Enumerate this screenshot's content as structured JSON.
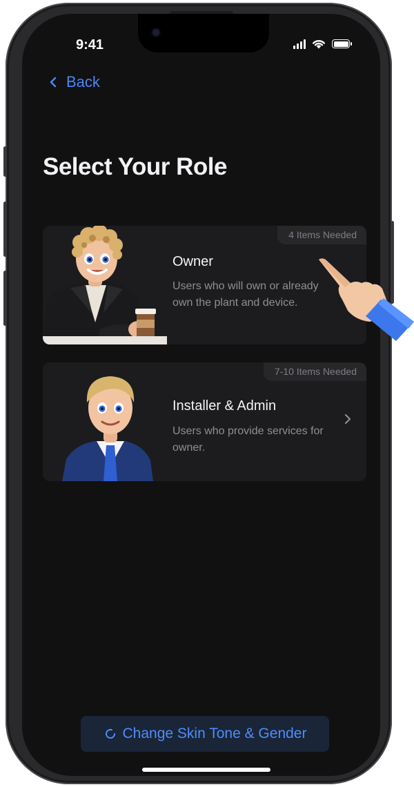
{
  "status_bar": {
    "time": "9:41"
  },
  "nav": {
    "back_label": "Back"
  },
  "page": {
    "title": "Select Your Role"
  },
  "roles": [
    {
      "badge": "4 Items Needed",
      "title": "Owner",
      "description": "Users who will own or already own the plant and device."
    },
    {
      "badge": "7-10 Items Needed",
      "title": "Installer & Admin",
      "description": "Users who provide services for owner."
    }
  ],
  "footer": {
    "skin_button_label": "Change Skin Tone & Gender"
  },
  "colors": {
    "accent": "#4a86f7",
    "background": "#111112",
    "card": "#1c1c1e"
  },
  "icons": [
    "back-chevron-icon",
    "signal-icon",
    "wifi-icon",
    "battery-icon",
    "chevron-right-icon",
    "refresh-icon",
    "pointing-hand-icon"
  ]
}
